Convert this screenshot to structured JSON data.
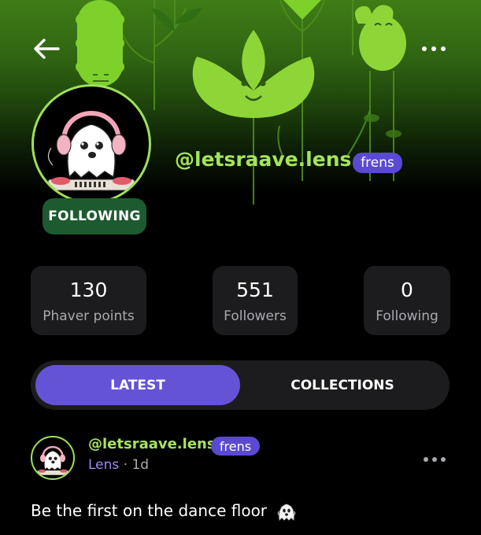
{
  "header": {
    "back_icon": "arrow-left-icon",
    "more_icon": "more-horizontal-icon"
  },
  "profile": {
    "handle": "@letsraave.lens",
    "badge": "frens",
    "follow_status": "FOLLOWING",
    "accent_color": "#a6e35e",
    "badge_color": "#5a4ad1"
  },
  "stats": [
    {
      "value": "130",
      "label": "Phaver points"
    },
    {
      "value": "551",
      "label": "Followers"
    },
    {
      "value": "0",
      "label": "Following"
    }
  ],
  "tabs": [
    {
      "label": "LATEST",
      "active": true
    },
    {
      "label": "COLLECTIONS",
      "active": false
    }
  ],
  "post": {
    "handle": "@letsraave.lens",
    "badge": "frens",
    "source": "Lens",
    "separator": " · ",
    "time": "1d",
    "text": "Be the first on the dance floor",
    "emoji_icon": "ghost-icon"
  }
}
